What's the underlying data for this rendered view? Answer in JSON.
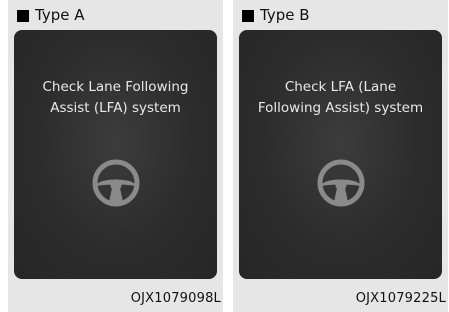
{
  "panels": [
    {
      "type_label": "Type A",
      "message_line1": "Check Lane Following",
      "message_line2": "Assist (LFA) system",
      "image_code": "OJX1079098L",
      "icon": "steering-wheel-icon"
    },
    {
      "type_label": "Type B",
      "message_line1": "Check LFA (Lane",
      "message_line2": "Following Assist) system",
      "image_code": "OJX1079225L",
      "icon": "steering-wheel-icon"
    }
  ],
  "colors": {
    "panel_background": "#e6e6e6",
    "screen_background": "#2c2c2c",
    "screen_text": "#e9e9e9",
    "icon_gray": "#8a8a8a"
  }
}
